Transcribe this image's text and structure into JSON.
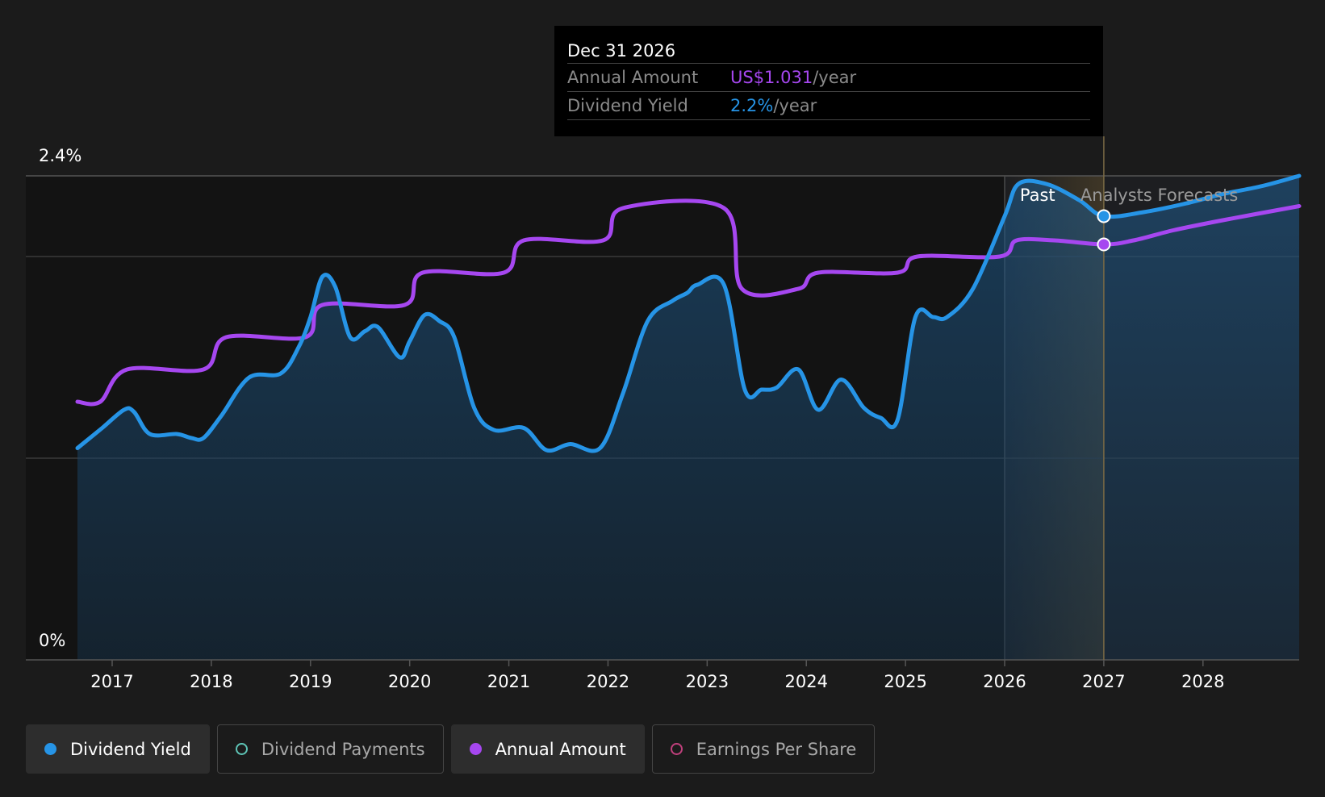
{
  "tooltip": {
    "date": "Dec 31 2026",
    "rows": [
      {
        "label": "Annual Amount",
        "value": "US$1.031",
        "unit": "/year",
        "color": "#a647f0"
      },
      {
        "label": "Dividend Yield",
        "value": "2.2%",
        "unit": "/year",
        "color": "#2694e6"
      }
    ]
  },
  "legend": [
    {
      "label": "Dividend Yield",
      "color": "#2694e6",
      "style": "filled",
      "active": true
    },
    {
      "label": "Dividend Payments",
      "color": "#5ec4b6",
      "style": "outline",
      "active": false
    },
    {
      "label": "Annual Amount",
      "color": "#a647f0",
      "style": "filled",
      "active": true
    },
    {
      "label": "Earnings Per Share",
      "color": "#c0407c",
      "style": "outline",
      "active": false
    }
  ],
  "chart_data": {
    "type": "line",
    "y_axis_labels": [
      "2.4%",
      "0%"
    ],
    "ylim": [
      0,
      2.4
    ],
    "xlim": [
      2016.65,
      2028.97
    ],
    "x_ticks": [
      2017,
      2018,
      2019,
      2020,
      2021,
      2022,
      2023,
      2024,
      2025,
      2026,
      2027,
      2028
    ],
    "x_tick_labels": [
      "2017",
      "2018",
      "2019",
      "2020",
      "2021",
      "2022",
      "2023",
      "2024",
      "2025",
      "2026",
      "2027",
      "2028"
    ],
    "region_labels": {
      "past": "Past",
      "forecast": "Analysts Forecasts"
    },
    "past_start": 2026.0,
    "forecast_start": 2027.0,
    "highlight_x": 2027.0,
    "series": [
      {
        "name": "Dividend Yield",
        "color": "#2694e6",
        "unit": "%",
        "area": true,
        "points": [
          [
            2016.65,
            1.05
          ],
          [
            2016.9,
            1.15
          ],
          [
            2017.12,
            1.24
          ],
          [
            2017.22,
            1.23
          ],
          [
            2017.38,
            1.12
          ],
          [
            2017.65,
            1.12
          ],
          [
            2017.8,
            1.1
          ],
          [
            2017.92,
            1.1
          ],
          [
            2018.1,
            1.21
          ],
          [
            2018.38,
            1.4
          ],
          [
            2018.7,
            1.42
          ],
          [
            2018.88,
            1.55
          ],
          [
            2019.0,
            1.7
          ],
          [
            2019.12,
            1.9
          ],
          [
            2019.25,
            1.85
          ],
          [
            2019.4,
            1.6
          ],
          [
            2019.55,
            1.63
          ],
          [
            2019.68,
            1.65
          ],
          [
            2019.9,
            1.5
          ],
          [
            2020.0,
            1.58
          ],
          [
            2020.15,
            1.71
          ],
          [
            2020.3,
            1.68
          ],
          [
            2020.45,
            1.6
          ],
          [
            2020.65,
            1.25
          ],
          [
            2020.85,
            1.14
          ],
          [
            2021.15,
            1.15
          ],
          [
            2021.38,
            1.04
          ],
          [
            2021.62,
            1.07
          ],
          [
            2021.92,
            1.05
          ],
          [
            2022.15,
            1.32
          ],
          [
            2022.4,
            1.68
          ],
          [
            2022.65,
            1.78
          ],
          [
            2022.8,
            1.82
          ],
          [
            2022.9,
            1.86
          ],
          [
            2023.17,
            1.86
          ],
          [
            2023.38,
            1.34
          ],
          [
            2023.55,
            1.34
          ],
          [
            2023.7,
            1.35
          ],
          [
            2023.92,
            1.44
          ],
          [
            2024.12,
            1.24
          ],
          [
            2024.35,
            1.39
          ],
          [
            2024.58,
            1.25
          ],
          [
            2024.75,
            1.2
          ],
          [
            2024.92,
            1.19
          ],
          [
            2025.1,
            1.7
          ],
          [
            2025.28,
            1.7
          ],
          [
            2025.42,
            1.7
          ],
          [
            2025.68,
            1.84
          ],
          [
            2026.0,
            2.2
          ],
          [
            2026.14,
            2.36
          ],
          [
            2026.42,
            2.36
          ],
          [
            2026.75,
            2.28
          ],
          [
            2027.0,
            2.2
          ],
          [
            2027.4,
            2.22
          ],
          [
            2027.8,
            2.26
          ],
          [
            2028.2,
            2.31
          ],
          [
            2028.6,
            2.35
          ],
          [
            2028.97,
            2.4
          ]
        ]
      },
      {
        "name": "Annual Amount",
        "color": "#a647f0",
        "unit": "US$",
        "area": false,
        "points": [
          [
            2016.65,
            1.28
          ],
          [
            2016.88,
            1.28
          ],
          [
            2017.15,
            1.44
          ],
          [
            2017.92,
            1.44
          ],
          [
            2018.15,
            1.6
          ],
          [
            2018.95,
            1.6
          ],
          [
            2019.12,
            1.76
          ],
          [
            2019.95,
            1.76
          ],
          [
            2020.13,
            1.92
          ],
          [
            2020.95,
            1.92
          ],
          [
            2021.15,
            2.08
          ],
          [
            2021.95,
            2.08
          ],
          [
            2022.15,
            2.24
          ],
          [
            2023.17,
            2.24
          ],
          [
            2023.35,
            1.84
          ],
          [
            2023.92,
            1.84
          ],
          [
            2024.12,
            1.92
          ],
          [
            2024.92,
            1.92
          ],
          [
            2025.12,
            2.0
          ],
          [
            2025.95,
            2.0
          ],
          [
            2026.12,
            2.08
          ],
          [
            2026.5,
            2.08
          ],
          [
            2027.0,
            2.06
          ],
          [
            2027.3,
            2.08
          ],
          [
            2027.7,
            2.13
          ],
          [
            2028.2,
            2.18
          ],
          [
            2028.97,
            2.25
          ]
        ]
      }
    ]
  }
}
